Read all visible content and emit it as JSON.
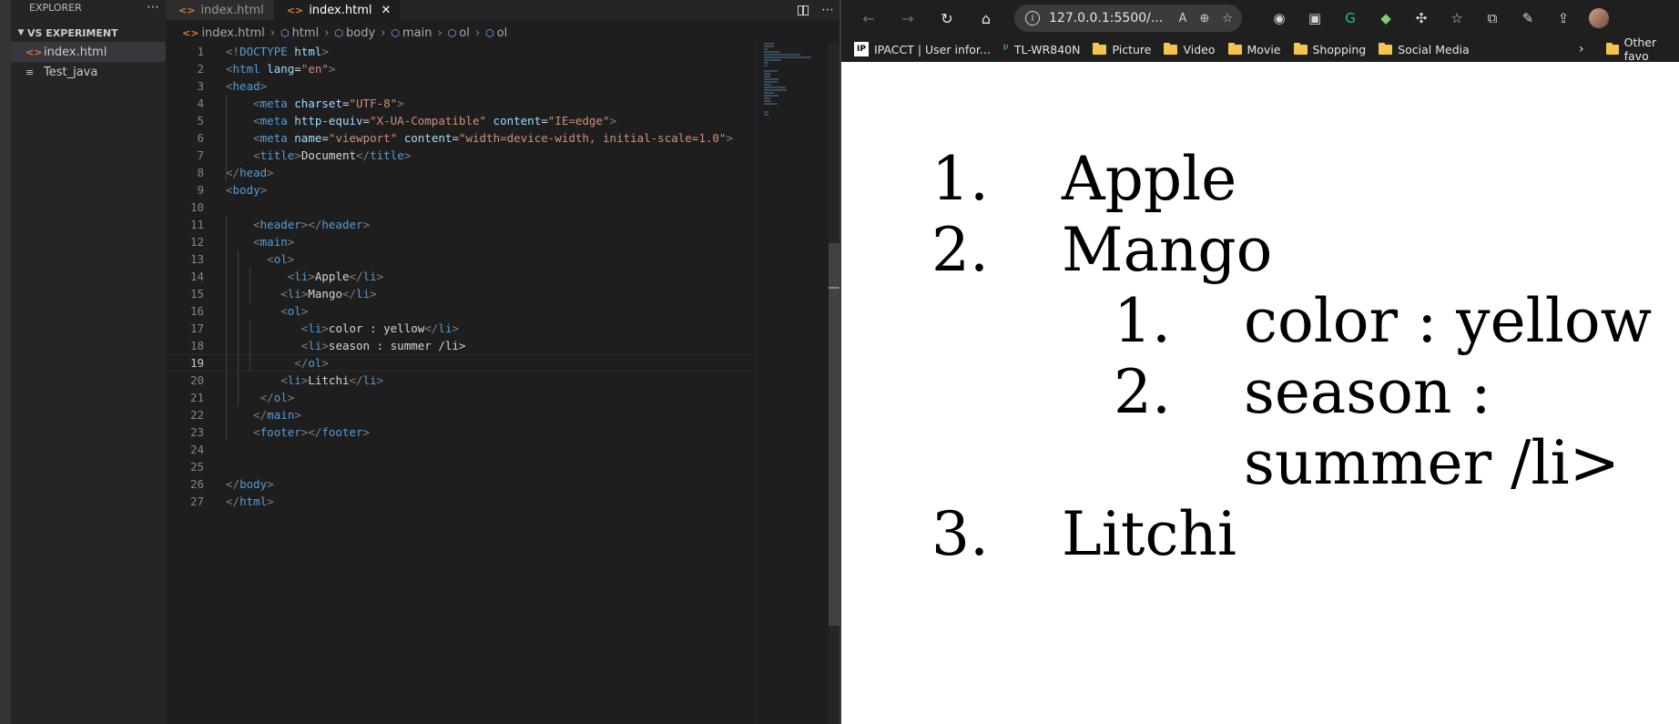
{
  "explorer": {
    "title": "EXPLORER",
    "folder": "VS EXPERIMENT",
    "files": [
      "index.html",
      "Test_java"
    ]
  },
  "editor": {
    "tabs": [
      {
        "label": "index.html",
        "active": false
      },
      {
        "label": "index.html",
        "active": true
      }
    ],
    "breadcrumb": [
      "index.html",
      "html",
      "body",
      "main",
      "ol",
      "ol"
    ],
    "current_line": 19,
    "lines": [
      {
        "n": "1",
        "t": [
          [
            "br",
            "<!"
          ],
          [
            "tag",
            "DOCTYPE"
          ],
          [
            "txt",
            " "
          ],
          [
            "attr",
            "html"
          ],
          [
            "br",
            ">"
          ]
        ]
      },
      {
        "n": "2",
        "t": [
          [
            "br",
            "<"
          ],
          [
            "tag",
            "html"
          ],
          [
            "txt",
            " "
          ],
          [
            "attr",
            "lang"
          ],
          [
            "txt",
            "="
          ],
          [
            "val",
            "\"en\""
          ],
          [
            "br",
            ">"
          ]
        ]
      },
      {
        "n": "3",
        "t": [
          [
            "br",
            "<"
          ],
          [
            "tag",
            "head"
          ],
          [
            "br",
            ">"
          ]
        ]
      },
      {
        "n": "4",
        "t": [
          [
            "txt",
            "    "
          ],
          [
            "br",
            "<"
          ],
          [
            "tag",
            "meta"
          ],
          [
            "txt",
            " "
          ],
          [
            "attr",
            "charset"
          ],
          [
            "txt",
            "="
          ],
          [
            "val",
            "\"UTF-8\""
          ],
          [
            "br",
            ">"
          ]
        ]
      },
      {
        "n": "5",
        "t": [
          [
            "txt",
            "    "
          ],
          [
            "br",
            "<"
          ],
          [
            "tag",
            "meta"
          ],
          [
            "txt",
            " "
          ],
          [
            "attr",
            "http-equiv"
          ],
          [
            "txt",
            "="
          ],
          [
            "val",
            "\"X-UA-Compatible\""
          ],
          [
            "txt",
            " "
          ],
          [
            "attr",
            "content"
          ],
          [
            "txt",
            "="
          ],
          [
            "val",
            "\"IE=edge\""
          ],
          [
            "br",
            ">"
          ]
        ]
      },
      {
        "n": "6",
        "t": [
          [
            "txt",
            "    "
          ],
          [
            "br",
            "<"
          ],
          [
            "tag",
            "meta"
          ],
          [
            "txt",
            " "
          ],
          [
            "attr",
            "name"
          ],
          [
            "txt",
            "="
          ],
          [
            "val",
            "\"viewport\""
          ],
          [
            "txt",
            " "
          ],
          [
            "attr",
            "content"
          ],
          [
            "txt",
            "="
          ],
          [
            "val",
            "\"width=device-width, initial-scale=1.0\""
          ],
          [
            "br",
            ">"
          ]
        ]
      },
      {
        "n": "7",
        "t": [
          [
            "txt",
            "    "
          ],
          [
            "br",
            "<"
          ],
          [
            "tag",
            "title"
          ],
          [
            "br",
            ">"
          ],
          [
            "txt",
            "Document"
          ],
          [
            "br",
            "</"
          ],
          [
            "tag",
            "title"
          ],
          [
            "br",
            ">"
          ]
        ]
      },
      {
        "n": "8",
        "t": [
          [
            "br",
            "</"
          ],
          [
            "tag",
            "head"
          ],
          [
            "br",
            ">"
          ]
        ]
      },
      {
        "n": "9",
        "t": [
          [
            "br",
            "<"
          ],
          [
            "tag",
            "body"
          ],
          [
            "br",
            ">"
          ]
        ]
      },
      {
        "n": "10",
        "t": []
      },
      {
        "n": "11",
        "t": [
          [
            "txt",
            "    "
          ],
          [
            "br",
            "<"
          ],
          [
            "tag",
            "header"
          ],
          [
            "br",
            "></"
          ],
          [
            "tag",
            "header"
          ],
          [
            "br",
            ">"
          ]
        ]
      },
      {
        "n": "12",
        "t": [
          [
            "txt",
            "    "
          ],
          [
            "br",
            "<"
          ],
          [
            "tag",
            "main"
          ],
          [
            "br",
            ">"
          ]
        ]
      },
      {
        "n": "13",
        "t": [
          [
            "txt",
            "      "
          ],
          [
            "br",
            "<"
          ],
          [
            "tag",
            "ol"
          ],
          [
            "br",
            ">"
          ]
        ]
      },
      {
        "n": "14",
        "t": [
          [
            "txt",
            "         "
          ],
          [
            "br",
            "<"
          ],
          [
            "tag",
            "li"
          ],
          [
            "br",
            ">"
          ],
          [
            "txt",
            "Apple"
          ],
          [
            "br",
            "</"
          ],
          [
            "tag",
            "li"
          ],
          [
            "br",
            ">"
          ]
        ]
      },
      {
        "n": "15",
        "t": [
          [
            "txt",
            "        "
          ],
          [
            "br",
            "<"
          ],
          [
            "tag",
            "li"
          ],
          [
            "br",
            ">"
          ],
          [
            "txt",
            "Mango"
          ],
          [
            "br",
            "</"
          ],
          [
            "tag",
            "li"
          ],
          [
            "br",
            ">"
          ]
        ]
      },
      {
        "n": "16",
        "t": [
          [
            "txt",
            "        "
          ],
          [
            "br",
            "<"
          ],
          [
            "tag",
            "ol"
          ],
          [
            "br",
            ">"
          ]
        ]
      },
      {
        "n": "17",
        "t": [
          [
            "txt",
            "           "
          ],
          [
            "br",
            "<"
          ],
          [
            "tag",
            "li"
          ],
          [
            "br",
            ">"
          ],
          [
            "txt",
            "color : yellow"
          ],
          [
            "br",
            "</"
          ],
          [
            "tag",
            "li"
          ],
          [
            "br",
            ">"
          ]
        ]
      },
      {
        "n": "18",
        "t": [
          [
            "txt",
            "           "
          ],
          [
            "br",
            "<"
          ],
          [
            "tag",
            "li"
          ],
          [
            "br",
            ">"
          ],
          [
            "txt",
            "season : summer /li>"
          ]
        ]
      },
      {
        "n": "19",
        "t": [
          [
            "txt",
            "          "
          ],
          [
            "br",
            "</"
          ],
          [
            "tag",
            "ol"
          ],
          [
            "br",
            ">"
          ]
        ]
      },
      {
        "n": "20",
        "t": [
          [
            "txt",
            "        "
          ],
          [
            "br",
            "<"
          ],
          [
            "tag",
            "li"
          ],
          [
            "br",
            ">"
          ],
          [
            "txt",
            "Litchi"
          ],
          [
            "br",
            "</"
          ],
          [
            "tag",
            "li"
          ],
          [
            "br",
            ">"
          ]
        ]
      },
      {
        "n": "21",
        "t": [
          [
            "txt",
            "     "
          ],
          [
            "br",
            "</"
          ],
          [
            "tag",
            "ol"
          ],
          [
            "br",
            ">"
          ]
        ]
      },
      {
        "n": "22",
        "t": [
          [
            "txt",
            "    "
          ],
          [
            "br",
            "</"
          ],
          [
            "tag",
            "main"
          ],
          [
            "br",
            ">"
          ]
        ]
      },
      {
        "n": "23",
        "t": [
          [
            "txt",
            "    "
          ],
          [
            "br",
            "<"
          ],
          [
            "tag",
            "footer"
          ],
          [
            "br",
            "></"
          ],
          [
            "tag",
            "footer"
          ],
          [
            "br",
            ">"
          ]
        ]
      },
      {
        "n": "24",
        "t": []
      },
      {
        "n": "25",
        "t": []
      },
      {
        "n": "26",
        "t": [
          [
            "br",
            "</"
          ],
          [
            "tag",
            "body"
          ],
          [
            "br",
            ">"
          ]
        ]
      },
      {
        "n": "27",
        "t": [
          [
            "br",
            "</"
          ],
          [
            "tag",
            "html"
          ],
          [
            "br",
            ">"
          ]
        ]
      }
    ]
  },
  "browser": {
    "url": "127.0.0.1:5500/...",
    "bookmarks": [
      {
        "label": "IPACCT | User infor...",
        "icon": "ip-icon"
      },
      {
        "label": "TL-WR840N",
        "icon": "tplink-icon"
      },
      {
        "label": "Picture",
        "icon": "folder-icon"
      },
      {
        "label": "Video",
        "icon": "folder-icon"
      },
      {
        "label": "Movie",
        "icon": "folder-icon"
      },
      {
        "label": "Shopping",
        "icon": "folder-icon"
      },
      {
        "label": "Social Media",
        "icon": "folder-icon"
      }
    ],
    "other_favorites": "Other favo",
    "page": {
      "list": [
        {
          "num": "1.",
          "text": "Apple"
        },
        {
          "num": "2.",
          "text": "Mango"
        },
        {
          "num": "1.",
          "text": "color : yellow"
        },
        {
          "num": "2.",
          "text": "season :"
        },
        {
          "num": "",
          "text": "summer /li>"
        },
        {
          "num": "3.",
          "text": "Litchi"
        }
      ]
    }
  },
  "colors": {
    "tag": "#569cd6",
    "attr": "#9cdcfe",
    "value": "#ce9178",
    "html_icon": "#e37933",
    "folder": "#f4c44e"
  }
}
